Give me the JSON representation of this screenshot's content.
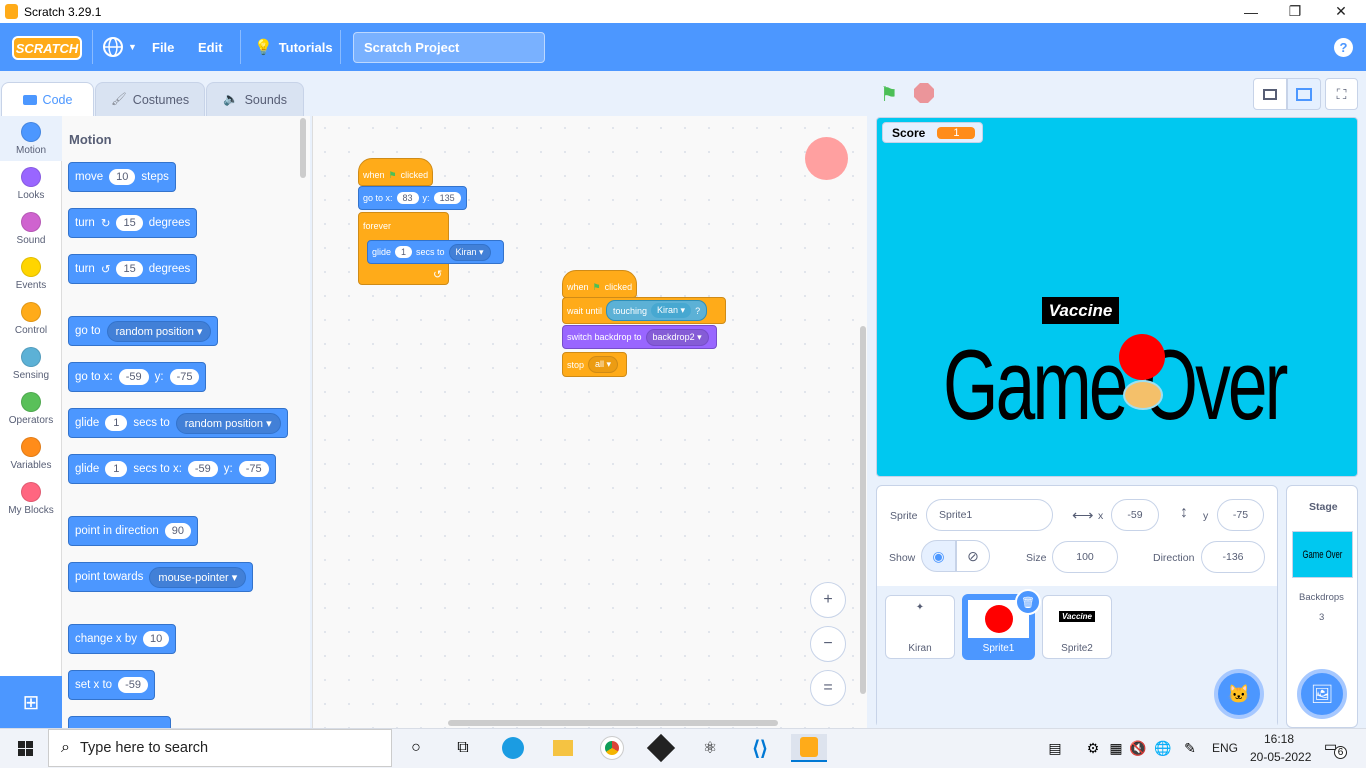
{
  "window": {
    "title": "Scratch 3.29.1",
    "minimize": "—",
    "maximize": "❐",
    "close": "✕"
  },
  "menu": {
    "logo": "SCRATCH",
    "file": "File",
    "edit": "Edit",
    "tutorials": "Tutorials",
    "project_title": "Scratch Project",
    "help": "?"
  },
  "tabs": {
    "code": "Code",
    "costumes": "Costumes",
    "sounds": "Sounds"
  },
  "categories": [
    {
      "label": "Motion",
      "color": "#4c97ff"
    },
    {
      "label": "Looks",
      "color": "#9966ff"
    },
    {
      "label": "Sound",
      "color": "#cf63cf"
    },
    {
      "label": "Events",
      "color": "#ffd500"
    },
    {
      "label": "Control",
      "color": "#ffab19"
    },
    {
      "label": "Sensing",
      "color": "#5cb1d6"
    },
    {
      "label": "Operators",
      "color": "#59c059"
    },
    {
      "label": "Variables",
      "color": "#ff8c1a"
    },
    {
      "label": "My Blocks",
      "color": "#ff6680"
    }
  ],
  "palette": {
    "heading": "Motion",
    "move": {
      "a": "move",
      "v": "10",
      "b": "steps"
    },
    "turn_right": {
      "a": "turn",
      "v": "15",
      "b": "degrees"
    },
    "turn_left": {
      "a": "turn",
      "v": "15",
      "b": "degrees"
    },
    "goto": {
      "a": "go to",
      "dd": "random position ▾"
    },
    "gotoxy": {
      "a": "go to x:",
      "x": "-59",
      "b": "y:",
      "y": "-75"
    },
    "glide": {
      "a": "glide",
      "v": "1",
      "b": "secs to",
      "dd": "random position ▾"
    },
    "glidexy": {
      "a": "glide",
      "v": "1",
      "b": "secs to x:",
      "x": "-59",
      "c": "y:",
      "y": "-75"
    },
    "point": {
      "a": "point in direction",
      "v": "90"
    },
    "towards": {
      "a": "point towards",
      "dd": "mouse-pointer ▾"
    },
    "changex": {
      "a": "change x by",
      "v": "10"
    },
    "setx": {
      "a": "set x to",
      "v": "-59"
    }
  },
  "script1": {
    "hat": "when",
    "hat2": "clicked",
    "goto": "go to x:",
    "x": "83",
    "y_lbl": "y:",
    "y": "135",
    "forever": "forever",
    "glide": "glide",
    "secs": "1",
    "secs_to": "secs to",
    "target": "Kiran ▾",
    "loop": "↺"
  },
  "script2": {
    "hat": "when",
    "hat2": "clicked",
    "wait": "wait until",
    "touching": "touching",
    "target": "Kiran ▾",
    "q": "?",
    "switch": "switch backdrop to",
    "backdrop": "backdrop2 ▾",
    "stop": "stop",
    "all": "all ▾"
  },
  "zoom": {
    "in": "+",
    "out": "−",
    "reset": "="
  },
  "stage": {
    "monitor_label": "Score",
    "monitor_value": "1",
    "vaccine": "Vaccine",
    "game_over": "Game Over"
  },
  "sprite_info": {
    "sprite_lbl": "Sprite",
    "sprite_name": "Sprite1",
    "x_lbl": "x",
    "x": "-59",
    "y_lbl": "y",
    "y": "-75",
    "show_lbl": "Show",
    "size_lbl": "Size",
    "size": "100",
    "dir_lbl": "Direction",
    "dir": "-136"
  },
  "sprites": [
    {
      "name": "Kiran"
    },
    {
      "name": "Sprite1"
    },
    {
      "name": "Sprite2",
      "thumb_text": "Vaccine"
    }
  ],
  "stage_panel": {
    "title": "Stage",
    "thumb_text": "Game Over",
    "backdrops_lbl": "Backdrops",
    "backdrops": "3"
  },
  "taskbar": {
    "search": "Type here to search",
    "lang": "ENG",
    "time": "16:18",
    "date": "20-05-2022",
    "notif": "6"
  }
}
